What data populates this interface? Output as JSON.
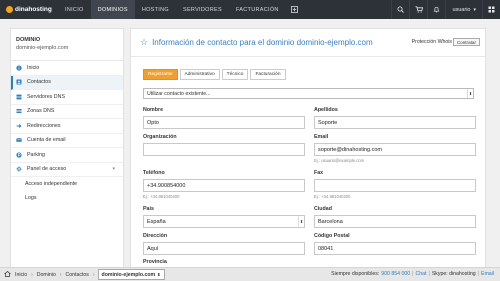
{
  "topnav": {
    "logo": "dinahosting",
    "items": [
      "INICIO",
      "DOMINIOS",
      "HOSTING",
      "SERVIDORES",
      "FACTURACIÓN"
    ],
    "user": "usuario"
  },
  "sidebar": {
    "title": "DOMINIO",
    "domain": "dominio-ejemplo.com",
    "items": [
      {
        "label": "Inicio",
        "icon": "info-icon"
      },
      {
        "label": "Contactos",
        "icon": "contacts-icon"
      },
      {
        "label": "Servidores DNS",
        "icon": "server-icon"
      },
      {
        "label": "Zonas DNS",
        "icon": "dns-icon"
      },
      {
        "label": "Redirecciones",
        "icon": "redirect-icon"
      },
      {
        "label": "Cuenta de email",
        "icon": "email-icon"
      },
      {
        "label": "Parking",
        "icon": "parking-icon"
      },
      {
        "label": "Panel de acceso",
        "icon": "gear-icon"
      }
    ],
    "subitems": [
      "Acceso independiente",
      "Logs"
    ]
  },
  "main": {
    "title": "Información de contacto para el dominio dominio-ejemplo.com",
    "privacy_label": "Protección Whois",
    "contract_label": "Contratar",
    "tabs": [
      "Registrante",
      "Administrativo",
      "Técnico",
      "Facturación"
    ],
    "contact_select": "Utilizar contacto existente...",
    "fields": {
      "nombre": {
        "label": "Nombre",
        "value": "Opto"
      },
      "apellidos": {
        "label": "Apellidos",
        "value": "Soporte"
      },
      "organizacion": {
        "label": "Organización",
        "value": ""
      },
      "email": {
        "label": "Email",
        "value": "soporte@dinahosting.com",
        "hint": "Ej.: usuario@example.com"
      },
      "telefono": {
        "label": "Teléfono",
        "value": "+34.900854000",
        "hint": "Ej.: +34.981040200"
      },
      "fax": {
        "label": "Fax",
        "value": "",
        "hint": "Ej.: +34.981040200"
      },
      "pais": {
        "label": "País",
        "value": "España"
      },
      "ciudad": {
        "label": "Ciudad",
        "value": "Barcelona"
      },
      "direccion": {
        "label": "Dirección",
        "value": "Aquí"
      },
      "codigo_postal": {
        "label": "Código Postal",
        "value": "08041"
      },
      "provincia": {
        "label": "Provincia",
        "value": ""
      }
    }
  },
  "bottombar": {
    "breadcrumb": [
      "Inicio",
      "Dominio",
      "Contactos"
    ],
    "current": "dominio-ejemplo.com",
    "always_available": "Siempre disponibles:",
    "phone": "900 854 000",
    "chat": "Chat",
    "skype": "Skype: dinahosting",
    "email": "Email"
  }
}
